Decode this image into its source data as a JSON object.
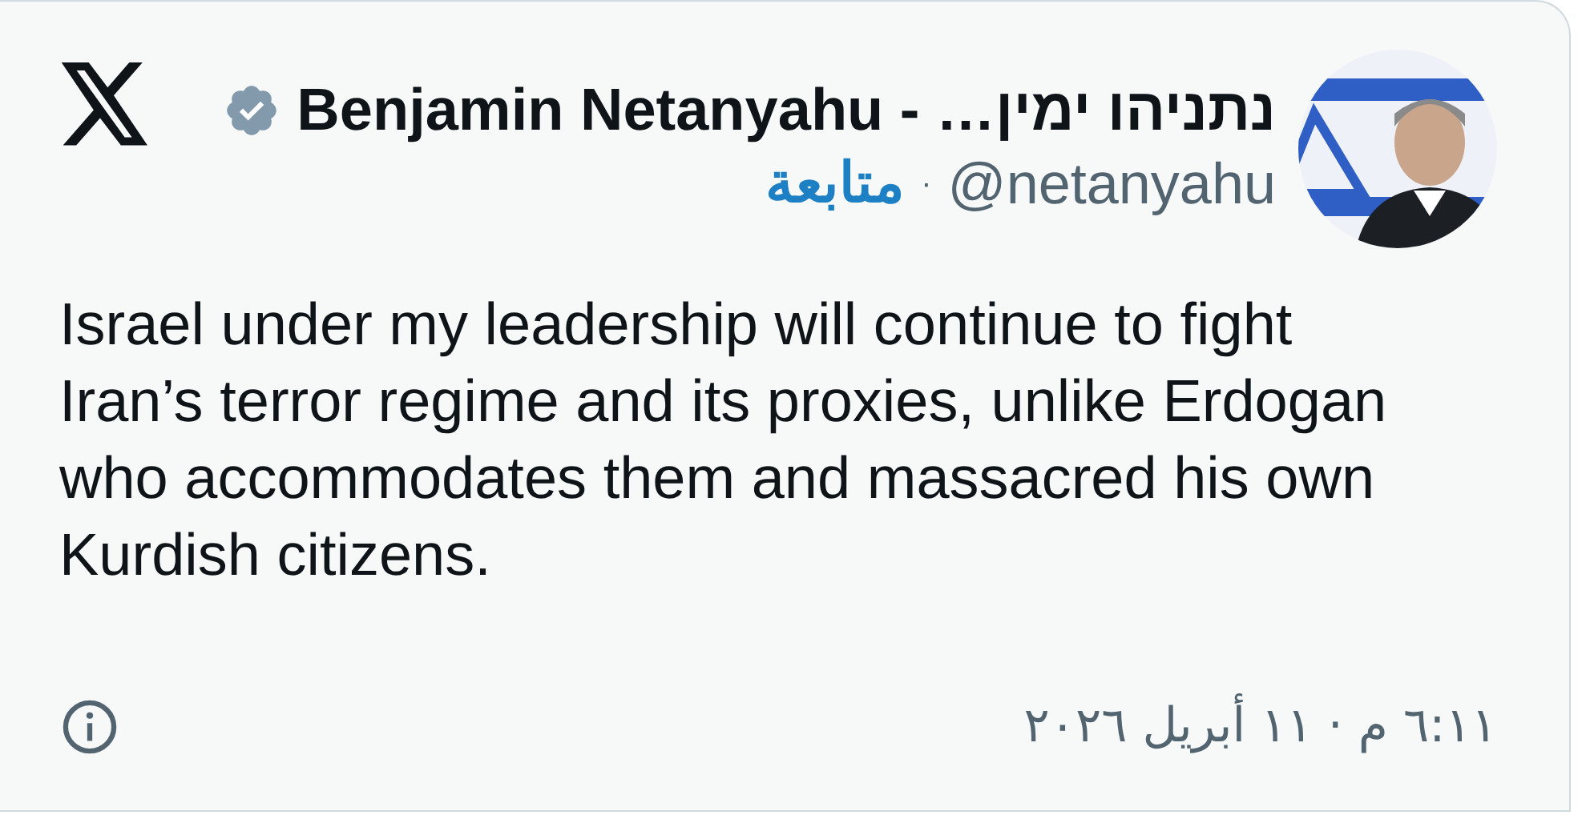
{
  "author": {
    "name": "נתניהו ימין… - Benjamin Netanyahu",
    "verified": true,
    "handle": "@netanyahu",
    "separator": "·",
    "follow": "متابعة"
  },
  "text": "Israel under my leadership will continue to fight Iran’s terror regime and its proxies, unlike Erdogan who accommodates them and massacred his own Kurdish citizens.",
  "timestamp": "٦:١١ م · ١١ أبريل ٢٠٢٦"
}
